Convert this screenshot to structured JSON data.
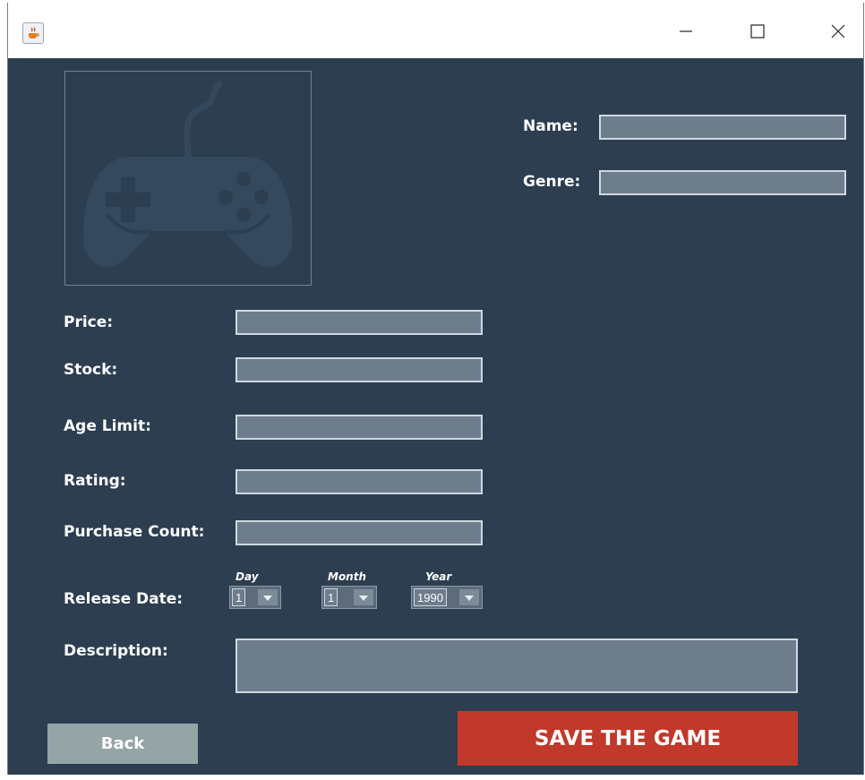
{
  "window": {
    "app_icon": "java-coffee-icon",
    "controls": {
      "minimize": "–",
      "maximize": "☐",
      "close": "✕"
    }
  },
  "image": {
    "placeholder_icon": "gamepad-icon",
    "colors": {
      "icon": "#34495e",
      "border": "#6e8194"
    }
  },
  "form": {
    "name_label": "Name:",
    "genre_label": "Genre:",
    "price_label": "Price:",
    "stock_label": "Stock:",
    "age_limit_label": "Age Limit:",
    "rating_label": "Rating:",
    "purchase_count_label": "Purchase Count:",
    "release_date_label": "Release Date:",
    "description_label": "Description:",
    "date": {
      "day_label": "Day",
      "month_label": "Month",
      "year_label": "Year",
      "day_value": "1",
      "month_value": "1",
      "year_value": "1990"
    }
  },
  "buttons": {
    "back": "Back",
    "save": "SAVE THE GAME"
  },
  "colors": {
    "background": "#2c3e50",
    "field": "#6e7d8c",
    "back_button": "#95a5a6",
    "save_button": "#c0392b"
  }
}
